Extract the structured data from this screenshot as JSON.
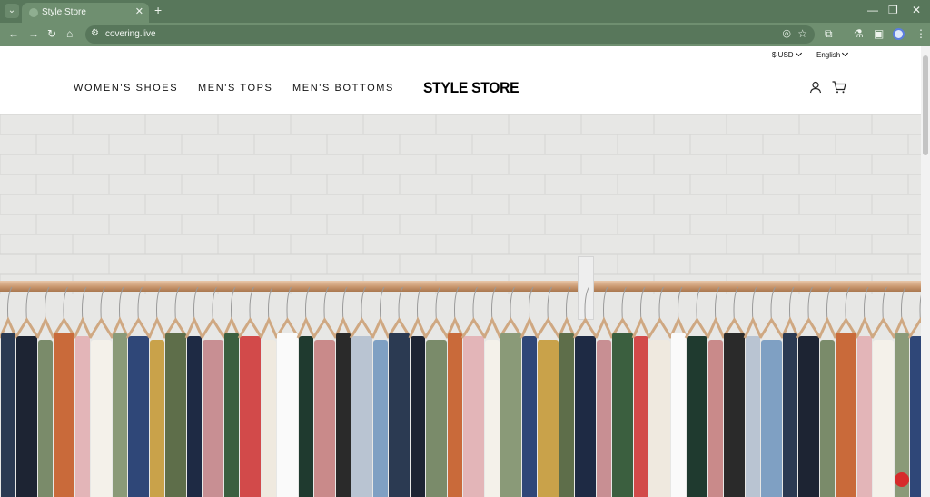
{
  "browser": {
    "tab_title": "Style Store",
    "url": "covering.live",
    "profile_color": "#5b7de0"
  },
  "colors": {
    "chrome_dark": "#58775b",
    "chrome_light": "#6f8f70",
    "logo": "#000000"
  },
  "store": {
    "currency_label": "$ USD",
    "language_label": "English",
    "nav": [
      "WOMEN'S SHOES",
      "MEN'S TOPS",
      "MEN'S BOTTOMS"
    ],
    "logo": "STYLE STORE",
    "icons": [
      "account-icon",
      "cart-icon"
    ]
  },
  "hero": {
    "description_icon": "clothing-rack-photo"
  }
}
